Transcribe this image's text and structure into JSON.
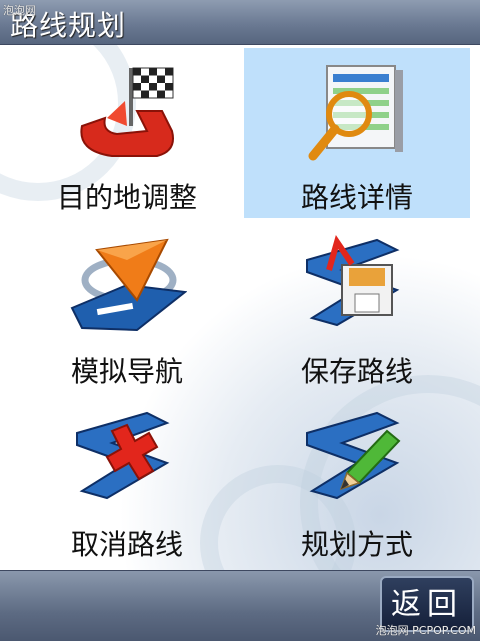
{
  "header": {
    "title": "路线规划"
  },
  "watermarks": {
    "top": "泡泡网",
    "bottom": "泡泡网 PCPOP.COM"
  },
  "menu": {
    "items": [
      {
        "label": "目的地调整",
        "icon": "destination-flag-icon"
      },
      {
        "label": "路线详情",
        "icon": "route-details-magnifier-icon"
      },
      {
        "label": "模拟导航",
        "icon": "simulate-navigation-arrow-icon"
      },
      {
        "label": "保存路线",
        "icon": "save-route-floppy-icon"
      },
      {
        "label": "取消路线",
        "icon": "cancel-route-x-icon"
      },
      {
        "label": "规划方式",
        "icon": "planning-mode-pencil-icon"
      }
    ],
    "selected_index": 1
  },
  "footer": {
    "back_label": "返回"
  },
  "colors": {
    "selected": "#bfe0fb",
    "bar": "#6b7a93",
    "accent_red": "#e2261c",
    "accent_blue": "#1f5fae"
  }
}
